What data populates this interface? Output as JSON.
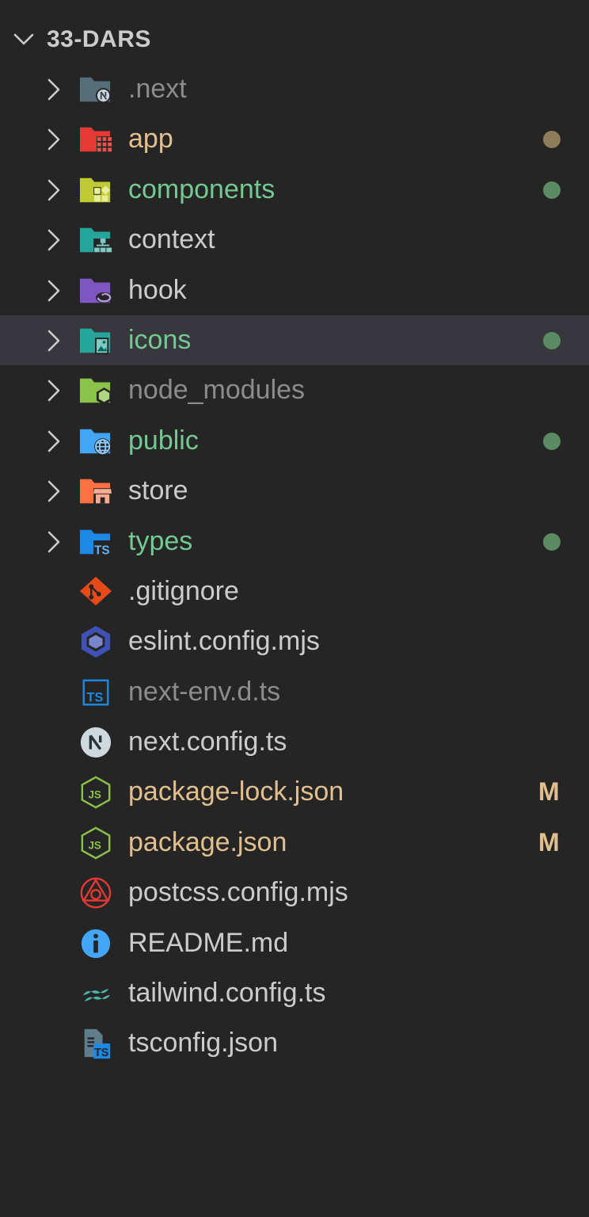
{
  "explorer": {
    "root_label": "33-DARS",
    "colors": {
      "background": "#252526",
      "selected_row": "#37373d",
      "default_text": "#cccccc",
      "ignored_text": "#8c8c8c",
      "modified_text": "#e2c08d",
      "untracked_text": "#73c991",
      "dot_modified": "#8f7c5b",
      "dot_untracked": "#5c8a63",
      "badge_modified": "#e2c08d"
    },
    "items": [
      {
        "label": ".next",
        "type": "folder",
        "icon": "nextjs-folder-icon",
        "state": "ignored"
      },
      {
        "label": "app",
        "type": "folder",
        "icon": "app-folder-icon",
        "state": "modified",
        "dot": true
      },
      {
        "label": "components",
        "type": "folder",
        "icon": "components-folder-icon",
        "state": "untracked",
        "dot": true
      },
      {
        "label": "context",
        "type": "folder",
        "icon": "context-folder-icon",
        "state": "normal"
      },
      {
        "label": "hook",
        "type": "folder",
        "icon": "hook-folder-icon",
        "state": "normal"
      },
      {
        "label": "icons",
        "type": "folder",
        "icon": "images-folder-icon",
        "state": "untracked",
        "dot": true,
        "selected": true
      },
      {
        "label": "node_modules",
        "type": "folder",
        "icon": "node-modules-folder-icon",
        "state": "ignored"
      },
      {
        "label": "public",
        "type": "folder",
        "icon": "public-folder-icon",
        "state": "untracked",
        "dot": true
      },
      {
        "label": "store",
        "type": "folder",
        "icon": "store-folder-icon",
        "state": "normal"
      },
      {
        "label": "types",
        "type": "folder",
        "icon": "typescript-folder-icon",
        "state": "untracked",
        "dot": true
      },
      {
        "label": ".gitignore",
        "type": "file",
        "icon": "git-icon",
        "state": "normal"
      },
      {
        "label": "eslint.config.mjs",
        "type": "file",
        "icon": "eslint-icon",
        "state": "normal"
      },
      {
        "label": "next-env.d.ts",
        "type": "file",
        "icon": "typescript-file-icon",
        "state": "ignored"
      },
      {
        "label": "next.config.ts",
        "type": "file",
        "icon": "nextjs-icon",
        "state": "normal"
      },
      {
        "label": "package-lock.json",
        "type": "file",
        "icon": "nodejs-icon",
        "state": "modified",
        "badge": "M"
      },
      {
        "label": "package.json",
        "type": "file",
        "icon": "nodejs-icon",
        "state": "modified",
        "badge": "M"
      },
      {
        "label": "postcss.config.mjs",
        "type": "file",
        "icon": "postcss-icon",
        "state": "normal"
      },
      {
        "label": "README.md",
        "type": "file",
        "icon": "info-icon",
        "state": "normal"
      },
      {
        "label": "tailwind.config.ts",
        "type": "file",
        "icon": "tailwind-icon",
        "state": "normal"
      },
      {
        "label": "tsconfig.json",
        "type": "file",
        "icon": "tsconfig-icon",
        "state": "normal"
      }
    ]
  }
}
